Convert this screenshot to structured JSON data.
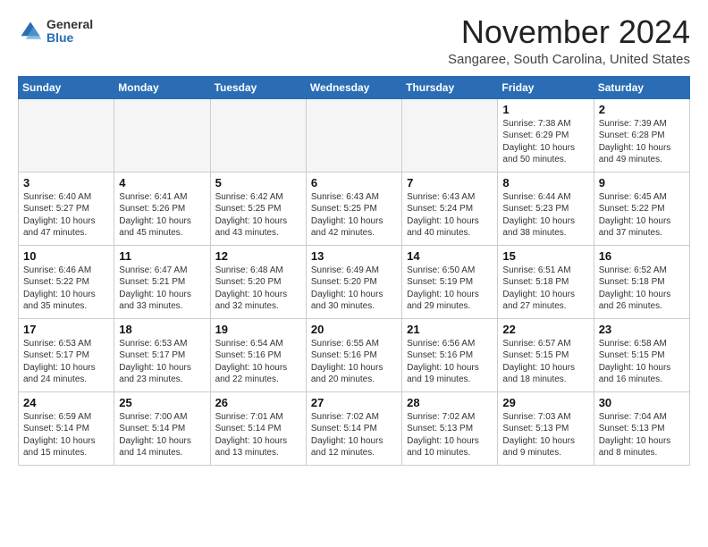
{
  "header": {
    "logo_general": "General",
    "logo_blue": "Blue",
    "month_title": "November 2024",
    "location": "Sangaree, South Carolina, United States"
  },
  "weekdays": [
    "Sunday",
    "Monday",
    "Tuesday",
    "Wednesday",
    "Thursday",
    "Friday",
    "Saturday"
  ],
  "weeks": [
    [
      {
        "day": "",
        "info": ""
      },
      {
        "day": "",
        "info": ""
      },
      {
        "day": "",
        "info": ""
      },
      {
        "day": "",
        "info": ""
      },
      {
        "day": "",
        "info": ""
      },
      {
        "day": "1",
        "info": "Sunrise: 7:38 AM\nSunset: 6:29 PM\nDaylight: 10 hours and 50 minutes."
      },
      {
        "day": "2",
        "info": "Sunrise: 7:39 AM\nSunset: 6:28 PM\nDaylight: 10 hours and 49 minutes."
      }
    ],
    [
      {
        "day": "3",
        "info": "Sunrise: 6:40 AM\nSunset: 5:27 PM\nDaylight: 10 hours and 47 minutes."
      },
      {
        "day": "4",
        "info": "Sunrise: 6:41 AM\nSunset: 5:26 PM\nDaylight: 10 hours and 45 minutes."
      },
      {
        "day": "5",
        "info": "Sunrise: 6:42 AM\nSunset: 5:25 PM\nDaylight: 10 hours and 43 minutes."
      },
      {
        "day": "6",
        "info": "Sunrise: 6:43 AM\nSunset: 5:25 PM\nDaylight: 10 hours and 42 minutes."
      },
      {
        "day": "7",
        "info": "Sunrise: 6:43 AM\nSunset: 5:24 PM\nDaylight: 10 hours and 40 minutes."
      },
      {
        "day": "8",
        "info": "Sunrise: 6:44 AM\nSunset: 5:23 PM\nDaylight: 10 hours and 38 minutes."
      },
      {
        "day": "9",
        "info": "Sunrise: 6:45 AM\nSunset: 5:22 PM\nDaylight: 10 hours and 37 minutes."
      }
    ],
    [
      {
        "day": "10",
        "info": "Sunrise: 6:46 AM\nSunset: 5:22 PM\nDaylight: 10 hours and 35 minutes."
      },
      {
        "day": "11",
        "info": "Sunrise: 6:47 AM\nSunset: 5:21 PM\nDaylight: 10 hours and 33 minutes."
      },
      {
        "day": "12",
        "info": "Sunrise: 6:48 AM\nSunset: 5:20 PM\nDaylight: 10 hours and 32 minutes."
      },
      {
        "day": "13",
        "info": "Sunrise: 6:49 AM\nSunset: 5:20 PM\nDaylight: 10 hours and 30 minutes."
      },
      {
        "day": "14",
        "info": "Sunrise: 6:50 AM\nSunset: 5:19 PM\nDaylight: 10 hours and 29 minutes."
      },
      {
        "day": "15",
        "info": "Sunrise: 6:51 AM\nSunset: 5:18 PM\nDaylight: 10 hours and 27 minutes."
      },
      {
        "day": "16",
        "info": "Sunrise: 6:52 AM\nSunset: 5:18 PM\nDaylight: 10 hours and 26 minutes."
      }
    ],
    [
      {
        "day": "17",
        "info": "Sunrise: 6:53 AM\nSunset: 5:17 PM\nDaylight: 10 hours and 24 minutes."
      },
      {
        "day": "18",
        "info": "Sunrise: 6:53 AM\nSunset: 5:17 PM\nDaylight: 10 hours and 23 minutes."
      },
      {
        "day": "19",
        "info": "Sunrise: 6:54 AM\nSunset: 5:16 PM\nDaylight: 10 hours and 22 minutes."
      },
      {
        "day": "20",
        "info": "Sunrise: 6:55 AM\nSunset: 5:16 PM\nDaylight: 10 hours and 20 minutes."
      },
      {
        "day": "21",
        "info": "Sunrise: 6:56 AM\nSunset: 5:16 PM\nDaylight: 10 hours and 19 minutes."
      },
      {
        "day": "22",
        "info": "Sunrise: 6:57 AM\nSunset: 5:15 PM\nDaylight: 10 hours and 18 minutes."
      },
      {
        "day": "23",
        "info": "Sunrise: 6:58 AM\nSunset: 5:15 PM\nDaylight: 10 hours and 16 minutes."
      }
    ],
    [
      {
        "day": "24",
        "info": "Sunrise: 6:59 AM\nSunset: 5:14 PM\nDaylight: 10 hours and 15 minutes."
      },
      {
        "day": "25",
        "info": "Sunrise: 7:00 AM\nSunset: 5:14 PM\nDaylight: 10 hours and 14 minutes."
      },
      {
        "day": "26",
        "info": "Sunrise: 7:01 AM\nSunset: 5:14 PM\nDaylight: 10 hours and 13 minutes."
      },
      {
        "day": "27",
        "info": "Sunrise: 7:02 AM\nSunset: 5:14 PM\nDaylight: 10 hours and 12 minutes."
      },
      {
        "day": "28",
        "info": "Sunrise: 7:02 AM\nSunset: 5:13 PM\nDaylight: 10 hours and 10 minutes."
      },
      {
        "day": "29",
        "info": "Sunrise: 7:03 AM\nSunset: 5:13 PM\nDaylight: 10 hours and 9 minutes."
      },
      {
        "day": "30",
        "info": "Sunrise: 7:04 AM\nSunset: 5:13 PM\nDaylight: 10 hours and 8 minutes."
      }
    ]
  ]
}
